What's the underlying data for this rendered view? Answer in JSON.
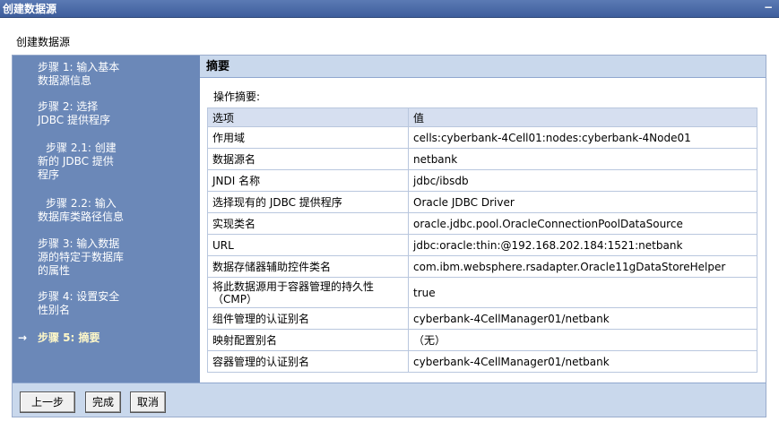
{
  "window": {
    "title": "创建数据源",
    "minimize_glyph": "−"
  },
  "page": {
    "heading": "创建数据源"
  },
  "steps": [
    {
      "lines": [
        "步骤 1: 输入基本",
        "数据源信息"
      ],
      "current": false
    },
    {
      "lines": [
        "步骤 2: 选择",
        "JDBC 提供程序"
      ],
      "current": false
    },
    {
      "lines": [
        "步骤 2.1: 创建",
        "新的 JDBC 提供",
        "程序"
      ],
      "current": false
    },
    {
      "lines": [
        "步骤 2.2: 输入",
        "数据库类路径信息"
      ],
      "current": false
    },
    {
      "lines": [
        "步骤 3: 输入数据",
        "源的特定于数据库",
        "的属性"
      ],
      "current": false
    },
    {
      "lines": [
        "步骤 4: 设置安全",
        "性别名"
      ],
      "current": false
    },
    {
      "lines": [
        "步骤 5: 摘要"
      ],
      "current": true
    }
  ],
  "current_arrow": "→",
  "summary": {
    "title": "摘要",
    "op_label": "操作摘要:",
    "columns": [
      "选项",
      "值"
    ],
    "rows": [
      [
        "作用域",
        "cells:cyberbank-4Cell01:nodes:cyberbank-4Node01"
      ],
      [
        "数据源名",
        "netbank"
      ],
      [
        "JNDI 名称",
        "jdbc/ibsdb"
      ],
      [
        "选择现有的 JDBC 提供程序",
        "Oracle JDBC Driver"
      ],
      [
        "实现类名",
        "oracle.jdbc.pool.OracleConnectionPoolDataSource"
      ],
      [
        "URL",
        "jdbc:oracle:thin:@192.168.202.184:1521:netbank"
      ],
      [
        "数据存储器辅助控件类名",
        "com.ibm.websphere.rsadapter.Oracle11gDataStoreHelper"
      ],
      [
        "将此数据源用于容器管理的持久性（CMP）",
        "true"
      ],
      [
        "组件管理的认证别名",
        "cyberbank-4CellManager01/netbank"
      ],
      [
        "映射配置别名",
        "（无）"
      ],
      [
        "容器管理的认证别名",
        "cyberbank-4CellManager01/netbank"
      ]
    ]
  },
  "buttons": {
    "previous": "上一步",
    "finish": "完成",
    "cancel": "取消"
  }
}
